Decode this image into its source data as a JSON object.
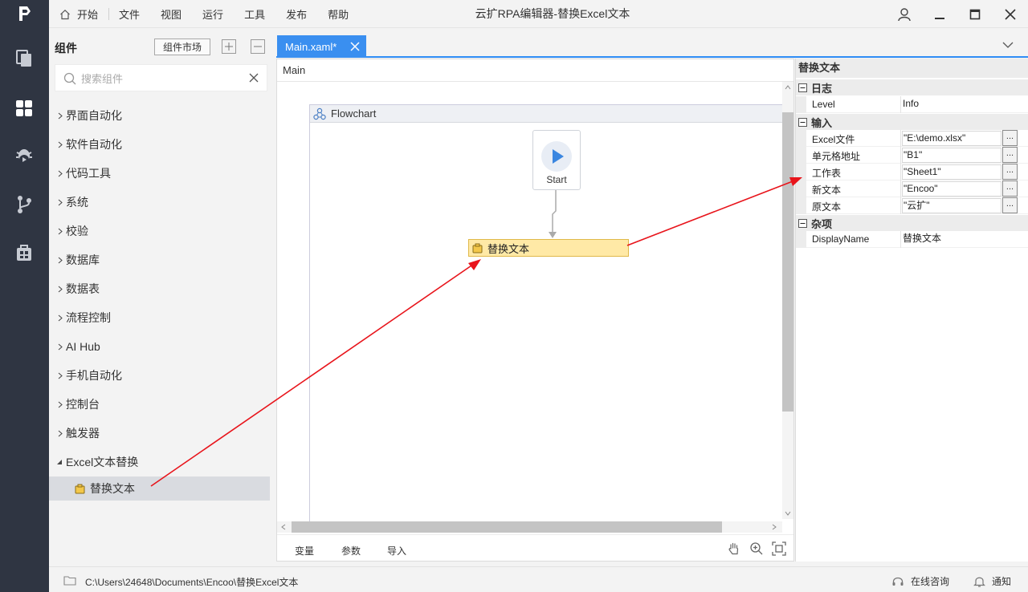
{
  "menu": {
    "items": [
      "开始",
      "文件",
      "视图",
      "运行",
      "工具",
      "发布",
      "帮助"
    ]
  },
  "window": {
    "title": "云扩RPA编辑器-替换Excel文本"
  },
  "components": {
    "title": "组件",
    "market_label": "组件市场",
    "search_placeholder": "搜索组件",
    "categories": [
      "界面自动化",
      "软件自动化",
      "代码工具",
      "系统",
      "校验",
      "数据库",
      "数据表",
      "流程控制",
      "AI Hub",
      "手机自动化",
      "控制台",
      "触发器",
      "Excel文本替换"
    ],
    "child": "替换文本"
  },
  "editor": {
    "tab_label": "Main.xaml*",
    "breadcrumb": "Main",
    "flowchart_label": "Flowchart",
    "start_label": "Start",
    "activity_label": "替换文本",
    "footer_tabs": [
      "变量",
      "参数",
      "导入"
    ]
  },
  "properties": {
    "title": "替换文本",
    "sections": {
      "log": "日志",
      "input": "输入",
      "misc": "杂项"
    },
    "rows": [
      {
        "name": "Level",
        "value": "Info"
      },
      {
        "name": "Excel文件",
        "value": "\"E:\\demo.xlsx\""
      },
      {
        "name": "单元格地址",
        "value": "\"B1\""
      },
      {
        "name": "工作表",
        "value": "\"Sheet1\""
      },
      {
        "name": "新文本",
        "value": "\"Encoo\""
      },
      {
        "name": "原文本",
        "value": "\"云扩\""
      },
      {
        "name": "DisplayName",
        "value": "替换文本"
      }
    ],
    "ellipsis": "..."
  },
  "status": {
    "path": "C:\\Users\\24648\\Documents\\Encoo\\替换Excel文本",
    "consult": "在线咨询",
    "notify": "通知"
  },
  "colors": {
    "accent": "#3a8ff0",
    "rail": "#2f3542",
    "activity_fill": "#ffe9a6",
    "annotation_arrow": "#e8141b"
  }
}
